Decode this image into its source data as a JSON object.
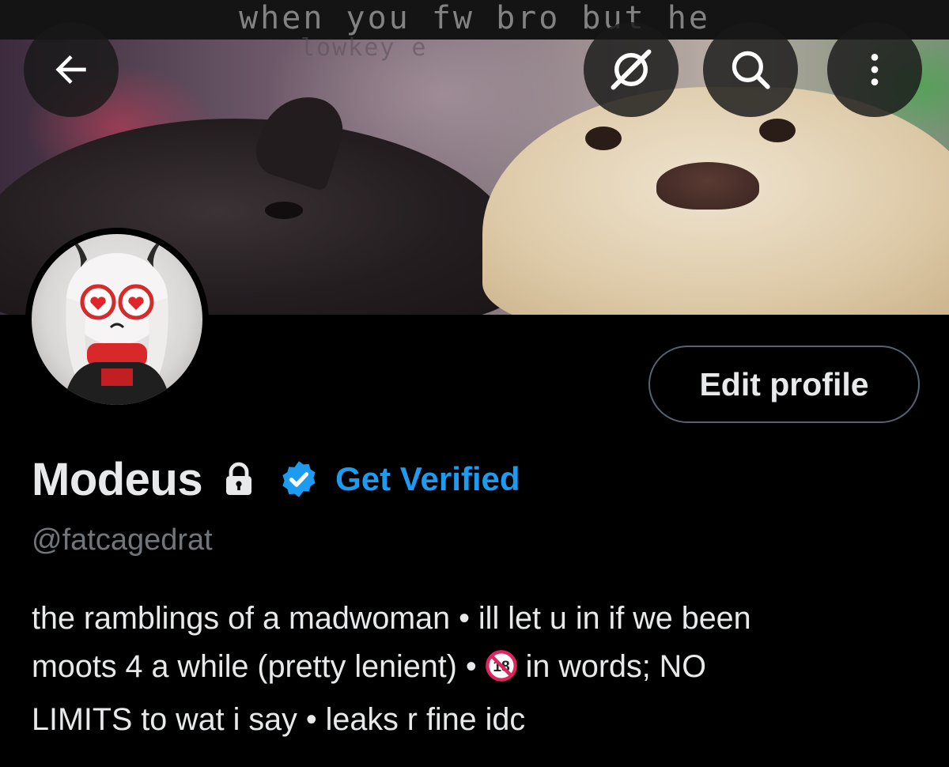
{
  "header": {
    "banner_caption_line1": "when you fw bro but he",
    "banner_caption_line2": "lowkey e",
    "buttons": {
      "back": "back-arrow-icon",
      "grok": "grok-icon",
      "search": "search-icon",
      "more": "more-vertical-icon"
    }
  },
  "profile": {
    "display_name": "Modeus",
    "protected": true,
    "get_verified_label": "Get Verified",
    "handle": "@fatcagedrat",
    "edit_profile_label": "Edit profile",
    "bio": {
      "line1": "the ramblings of a madwoman • ill let u in if we been",
      "line2_before_icon": "moots 4 a while (pretty lenient) • ",
      "line2_after_icon": " in words; NO",
      "line3": "LIMITS to wat i say • leaks r fine idc"
    }
  },
  "colors": {
    "background": "#000000",
    "text_primary": "#e7e9ea",
    "text_secondary": "#71767b",
    "accent_blue": "#1d9bf0",
    "button_border": "#536471",
    "no18_red": "#e0245e"
  }
}
